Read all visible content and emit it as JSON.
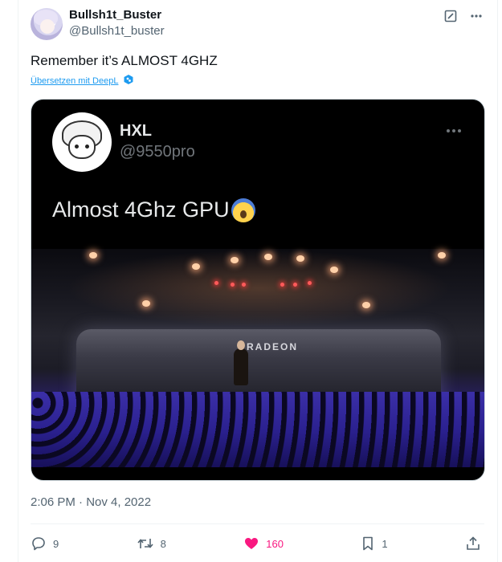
{
  "author": {
    "display_name": "Bullsh1t_Buster",
    "handle": "@Bullsh1t_buster"
  },
  "tweet": {
    "text": "Remember it’s ALMOST 4GHZ",
    "translate_label": "Übersetzen mit DeepL",
    "timestamp": "2:06 PM · Nov 4, 2022"
  },
  "quoted_media": {
    "author_name": "HXL",
    "author_handle": "@9550pro",
    "text": "Almost 4Ghz GPU",
    "stage_sign": "RADEON"
  },
  "actions": {
    "replies": "9",
    "retweets": "8",
    "likes": "160",
    "bookmarks": "1"
  },
  "colors": {
    "accent": "#1d9bf0",
    "like": "#f91880",
    "muted": "#536471"
  },
  "icons": {
    "edit": "edit-icon",
    "more": "more-icon",
    "deepl": "deepl-icon",
    "reply": "reply-icon",
    "retweet": "retweet-icon",
    "like": "heart-icon",
    "bookmark": "bookmark-icon",
    "share": "share-icon"
  }
}
